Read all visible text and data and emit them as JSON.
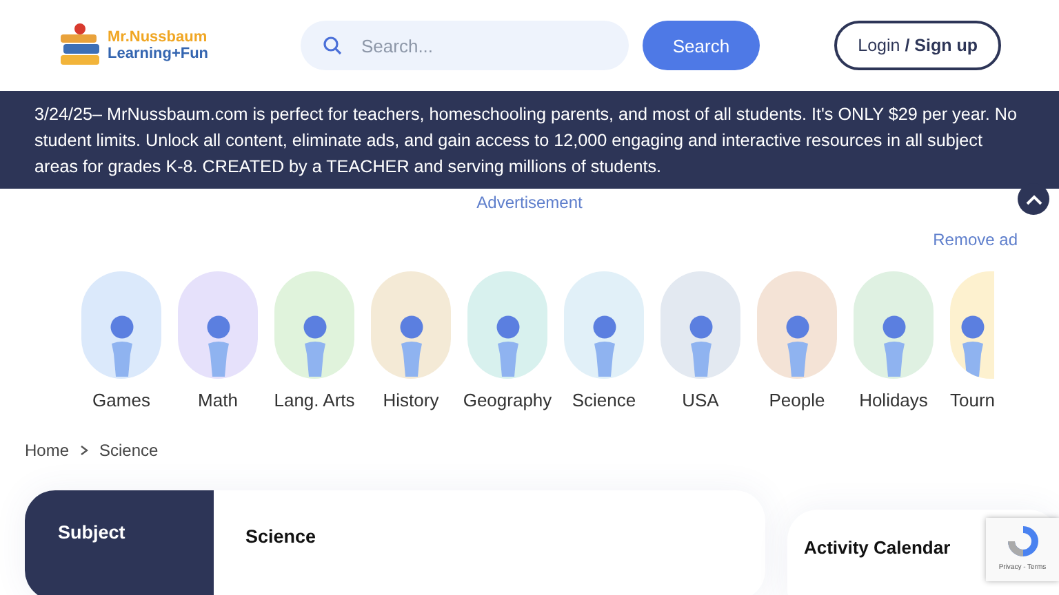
{
  "header": {
    "logo": {
      "line_1": "Mr.Nussbaum",
      "line_2": "Learning+Fun"
    },
    "search": {
      "placeholder": "Search..."
    },
    "search_button": "Search",
    "login_button": "Login **/ Sign up**"
  },
  "banner": {
    "text": "3/24/25– MrNussbaum.com is perfect for teachers, homeschooling parents, and most of all students. It's ONLY $29 per year. No student limits. Unlock all content, eliminate ads, and gain access to 12,000 engaging and interactive resources in all subject areas for grades K-8. CREATED by a TEACHER and serving millions of students."
  },
  "advertisement": {
    "label": "Advertisement",
    "remove_link": "Remove ad"
  },
  "categories": [
    {
      "label": "Games",
      "color": "#dbe9fb"
    },
    {
      "label": "Math",
      "color": "#e6e1fb"
    },
    {
      "label": "Lang. Arts",
      "color": "#e0f3dc"
    },
    {
      "label": "History",
      "color": "#f4ead6"
    },
    {
      "label": "Geography",
      "color": "#d8f1ee"
    },
    {
      "label": "Science",
      "color": "#e1f0f8"
    },
    {
      "label": "USA",
      "color": "#e3e9f1"
    },
    {
      "label": "People",
      "color": "#f4e3d6"
    },
    {
      "label": "Holidays",
      "color": "#dff1e2"
    },
    {
      "label": "Tourn",
      "color": "#fdf1cf"
    }
  ],
  "breadcrumb": [
    {
      "label": "Home"
    },
    {
      "label": "Science"
    }
  ],
  "subject_card": {
    "tab": "Subject",
    "title": "Science"
  },
  "calendar_card": {
    "title": "Activity Calendar"
  },
  "recaptcha": {
    "links": "Privacy - Terms"
  }
}
